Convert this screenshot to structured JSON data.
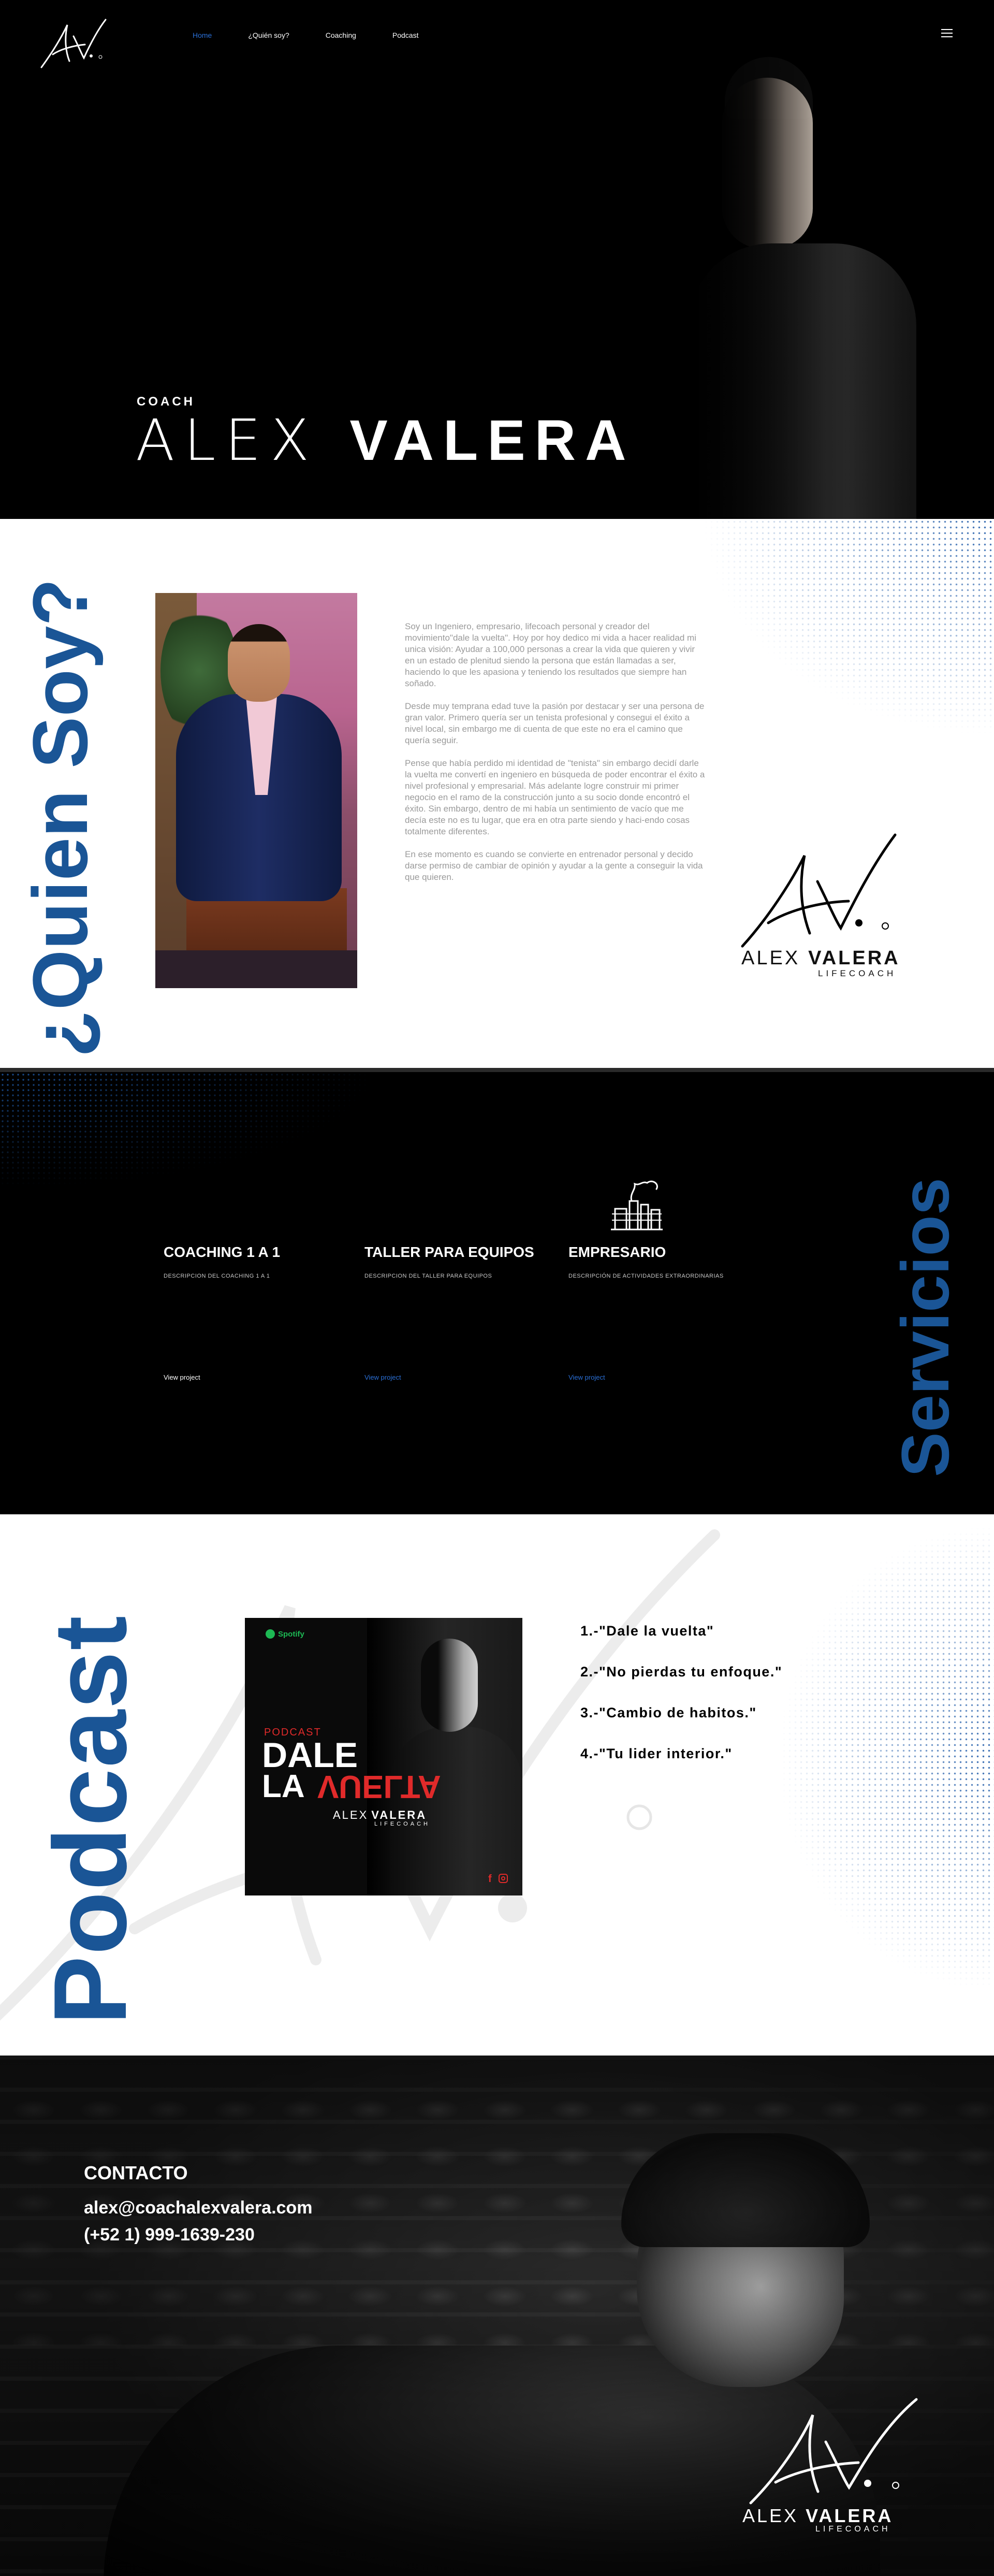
{
  "nav": {
    "items": [
      {
        "label": "Home",
        "active": true
      },
      {
        "label": "¿Quién soy?"
      },
      {
        "label": "Coaching"
      },
      {
        "label": "Podcast"
      }
    ],
    "menu_icon": "hamburger-icon",
    "accent_color": "#2a6fd6"
  },
  "hero": {
    "eyebrow": "COACH",
    "first_name": "ALEX",
    "last_name": "VALERA"
  },
  "about": {
    "title": "¿Quien Soy?",
    "paragraphs": [
      "Soy un Ingeniero, empresario, lifecoach personal y creador del movimiento\"dale la vuelta\". Hoy por hoy dedico mi vida a hacer realidad mi unica visión: Ayudar a 100,000 personas a crear la vida que quieren y vivir en un estado de plenitud siendo la persona que están llamadas a ser, haciendo lo que les apasiona y teniendo los resultados que siempre han soñado.",
      "Desde muy temprana edad tuve la pasión por destacar y ser una persona de gran valor. Primero quería ser un tenista profesional y consegui el éxito a nivel local, sin embargo me di cuenta de que este no era el camino que quería seguir.",
      " Pense que había perdido mi identidad de \"tenista\" sin embargo decidí darle la vuelta me convertí en ingeniero en búsqueda de poder encontrar el éxito a nivel profesional y empresarial. Más adelante logre construir mi  primer negocio en el ramo de la construcción junto a su socio donde encontró el éxito. Sin embargo, dentro de mi había un sentimiento de vacío que me decía este no es tu lugar, que era en otra parte siendo y haci-endo cosas totalmente diferentes.",
      "En ese momento es cuando se convierte en entrenador personal y decido darse permiso de cambiar de opinión y ayudar a la gente a conseguir la vida que quieren."
    ],
    "signature_first": "ALEX",
    "signature_last": "VALERA",
    "signature_role": "LIFECOACH",
    "title_color": "#1a5596"
  },
  "services": {
    "title": "Servicios",
    "items": [
      {
        "title": "COACHING 1 A 1",
        "desc": "DESCRIPCION DEL COACHING 1 A 1",
        "link": "View project"
      },
      {
        "title": "TALLER PARA EQUIPOS",
        "desc": "DESCRIPCION DEL TALLER PARA EQUIPOS",
        "link": "View project"
      },
      {
        "title": "EMPRESARIO",
        "desc": "DESCRIPCIÓN DE ACTIVIDADES EXTRAORDINARIAS",
        "link": "View project",
        "icon": "factory-icon"
      }
    ]
  },
  "podcast": {
    "title": "Podcast",
    "cover": {
      "platform": "Spotify",
      "kicker": "PODCAST",
      "line1": "DALE",
      "line2a": "LA",
      "line2b": "VUELTA",
      "name_first": "ALEX",
      "name_last": "VALERA",
      "role": "LIFECOACH"
    },
    "episodes": [
      "1.-\"Dale la vuelta\"",
      "2.-\"No pierdas tu enfoque.\"",
      "3.-\"Cambio de habitos.\"",
      "4.-\"Tu lider interior.\""
    ]
  },
  "contact": {
    "title": "CONTACTO",
    "email": "alex@coachalexvalera.com",
    "phone": "(+52 1) 999-1639-230",
    "signature_first": "ALEX",
    "signature_last": "VALERA",
    "signature_role": "LIFECOACH"
  }
}
